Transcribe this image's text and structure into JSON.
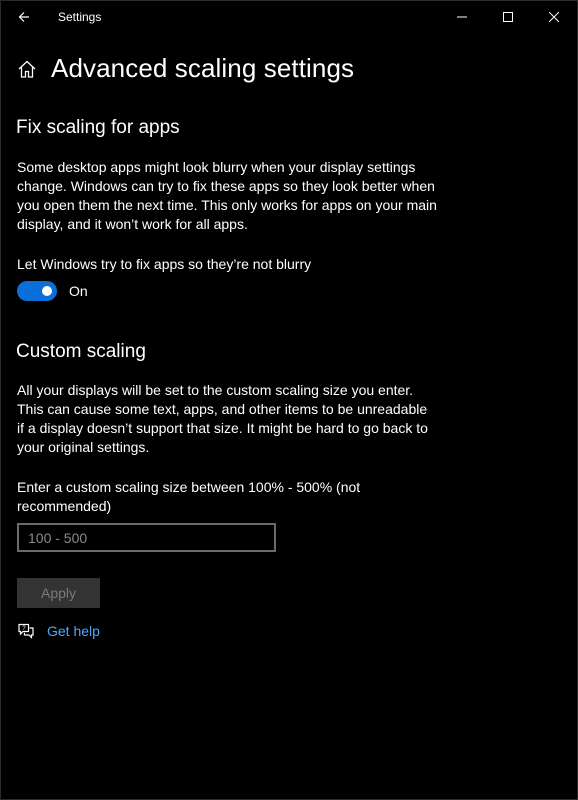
{
  "titlebar": {
    "app_title": "Settings",
    "back_icon": "back-arrow-icon",
    "minimize_icon": "minimize-icon",
    "maximize_icon": "maximize-icon",
    "close_icon": "close-icon"
  },
  "header": {
    "icon": "home-icon",
    "title": "Advanced scaling settings"
  },
  "fix_scaling": {
    "heading": "Fix scaling for apps",
    "description": "Some desktop apps might look blurry when your display settings change. Windows can try to fix these apps so they look better when you open them the next time. This only works for apps on your main display, and it won’t work for all apps.",
    "toggle_label": "Let Windows try to fix apps so they’re not blurry",
    "toggle_state": "On",
    "toggle_on": true
  },
  "custom_scaling": {
    "heading": "Custom scaling",
    "description": "All your displays will be set to the custom scaling size you enter. This can cause some text, apps, and other items to be unreadable if a display doesn’t support that size. It might be hard to go back to your original settings.",
    "input_label": "Enter a custom scaling size between 100% - 500% (not recommended)",
    "input_value": "",
    "input_placeholder": "100 - 500",
    "apply_label": "Apply"
  },
  "help": {
    "icon": "chat-help-icon",
    "link_label": "Get help"
  },
  "colors": {
    "background": "#000000",
    "accent": "#0a6fd8",
    "link": "#4ea7ff",
    "disabled_button": "#333333"
  }
}
